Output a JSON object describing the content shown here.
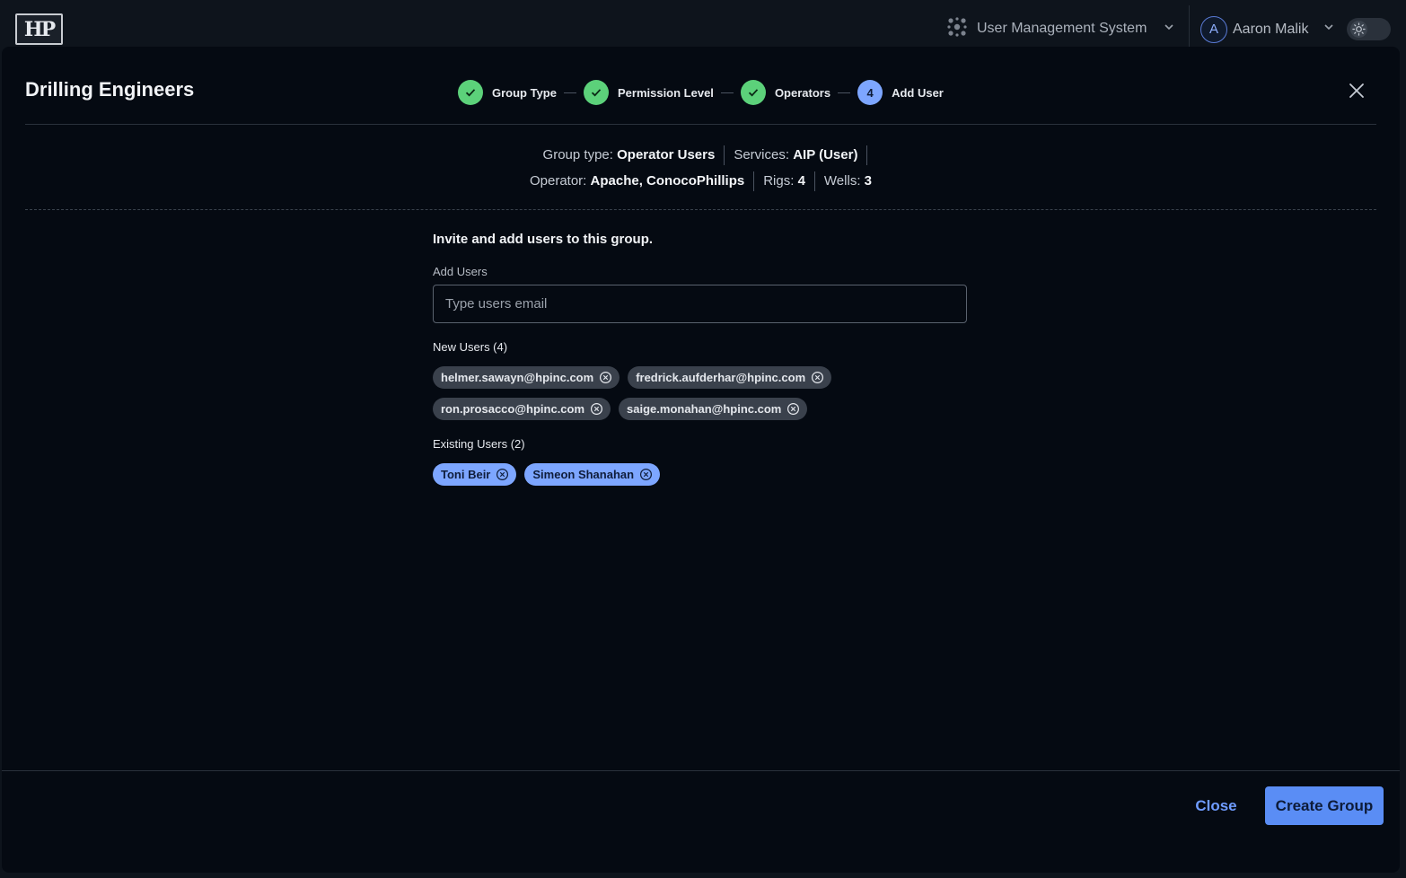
{
  "header": {
    "logo_text": "HP",
    "app_switcher": {
      "label": "User Management System",
      "icon": "apps-cluster-icon"
    },
    "user": {
      "initial": "A",
      "name": "Aaron Malik"
    },
    "theme_toggle": {
      "icon": "sun-icon"
    }
  },
  "modal": {
    "title": "Drilling Engineers",
    "steps": [
      {
        "label": "Group Type",
        "state": "done"
      },
      {
        "label": "Permission Level",
        "state": "done"
      },
      {
        "label": "Operators",
        "state": "done"
      },
      {
        "number": "4",
        "label": "Add User",
        "state": "current"
      }
    ],
    "summary": {
      "group_type_label": "Group type:",
      "group_type_value": "Operator Users",
      "services_label": "Services:",
      "services_value": "AIP (User)",
      "operator_label": "Operator:",
      "operator_value": "Apache, ConocoPhillips",
      "rigs_label": "Rigs:",
      "rigs_value": "4",
      "wells_label": "Wells:",
      "wells_value": "3"
    },
    "invite_title": "Invite and add users to this group.",
    "add_users_label": "Add Users",
    "email_placeholder": "Type users email",
    "new_users_label": "New Users (4)",
    "new_users": [
      "helmer.sawayn@hpinc.com",
      "fredrick.aufderhar@hpinc.com",
      "ron.prosacco@hpinc.com",
      "saige.monahan@hpinc.com"
    ],
    "existing_users_label": "Existing Users (2)",
    "existing_users": [
      "Toni Beir",
      "Simeon Shanahan"
    ],
    "close_label": "Close",
    "create_label": "Create Group"
  },
  "colors": {
    "accent": "#5a8df5",
    "step_done": "#5cd17a",
    "step_current": "#7da6ff",
    "background": "#050a12"
  }
}
